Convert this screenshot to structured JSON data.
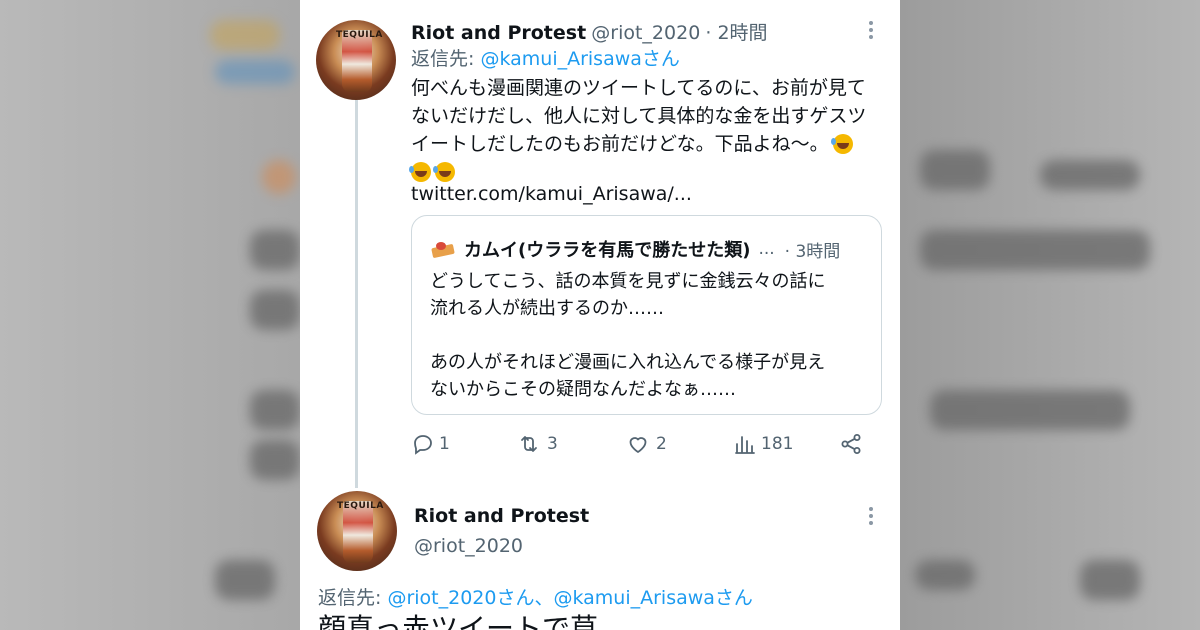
{
  "tweet1": {
    "author_name": "Riot and Protest",
    "author_handle": "@riot_2020",
    "time": "· 2時間",
    "reply_prefix": "返信先: ",
    "reply_to": "@kamui_Arisawaさん",
    "text_lines": [
      "何べんも漫画関連のツイートしてるのに、お前が見て",
      "ないだけだし、他人に対して具体的な金を出すゲスツ",
      "イートしだしたのもお前だけどな。下品よね〜。"
    ],
    "emoji_count_line1": 1,
    "emoji_count_line2": 2,
    "link": "twitter.com/kamui_Arisawa/...",
    "avatar_label": "TEQUILA",
    "quote": {
      "author_name": "カムイ(ウララを有馬で勝たせた類)",
      "ellipsis": "...",
      "time": "· 3時間",
      "paragraph1_lines": [
        "どうしてこう、話の本質を見ずに金銭云々の話に",
        "流れる人が続出するのか……"
      ],
      "paragraph2_lines": [
        "あの人がそれほど漫画に入れ込んでる様子が見え",
        "ないからこその疑問なんだよなぁ……"
      ]
    },
    "actions": {
      "replies": "1",
      "retweets": "3",
      "likes": "2",
      "views": "181"
    }
  },
  "tweet2": {
    "author_name": "Riot and Protest",
    "author_handle": "@riot_2020",
    "reply_prefix": "返信先: ",
    "reply_to": "@riot_2020さん、@kamui_Arisawaさん",
    "text_partial": "顔真っ赤ツイートで草"
  },
  "colors": {
    "link": "#1d9bf0",
    "secondary_text": "#536471",
    "border": "#cfd9de",
    "primary_text": "#0f1419"
  }
}
